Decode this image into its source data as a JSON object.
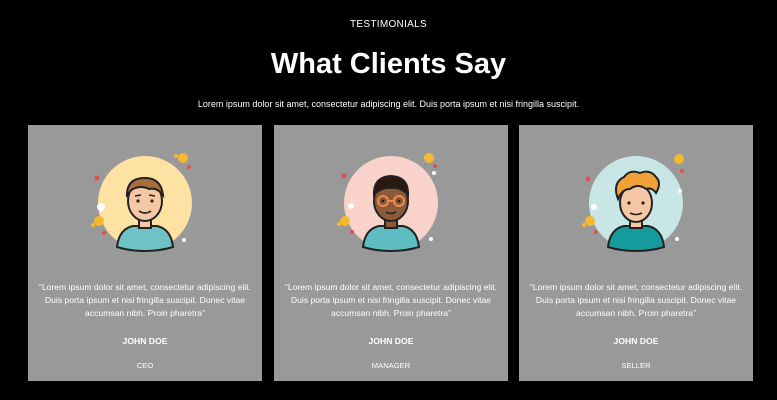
{
  "header": {
    "eyebrow": "TESTIMONIALS",
    "title": "What Clients Say",
    "subtitle": "Lorem ipsum dolor sit amet, consectetur adipiscing elit. Duis porta ipsum et nisi fringilla suscipit."
  },
  "colors": {
    "background": "#000000",
    "card": "#999999",
    "avatar_bg_1": "#fde2a3",
    "avatar_bg_2": "#f9d2cb",
    "avatar_bg_3": "#c9e6e6",
    "shirt_1": "#6fc3c6",
    "shirt_2": "#5dbdc2",
    "shirt_3": "#159b9b",
    "confetti_yellow": "#f5b82e",
    "confetti_red": "#e0504d"
  },
  "testimonials": [
    {
      "quote": "“Lorem ipsum dolor sit amet, consectetur adipiscing elit. Duis porta ipsum et nisi fringilla suscipit. Donec vitae accumsan nibh. Proin pharetra”",
      "name": "JOHN DOE",
      "role": "CEO",
      "avatar_icon": "man-brown-hair-avatar-icon"
    },
    {
      "quote": "“Lorem ipsum dolor sit amet, consectetur adipiscing elit. Duis porta ipsum et nisi fringilla suscipit. Donec vitae accumsan nibh. Proin pharetra”",
      "name": "JOHN DOE",
      "role": "MANAGER",
      "avatar_icon": "man-glasses-avatar-icon"
    },
    {
      "quote": "“Lorem ipsum dolor sit amet, consectetur adipiscing elit. Duis porta ipsum et nisi fringilla suscipit. Donec vitae accumsan nibh. Proin pharetra”",
      "name": "JOHN DOE",
      "role": "SELLER",
      "avatar_icon": "man-orange-hair-avatar-icon"
    }
  ]
}
